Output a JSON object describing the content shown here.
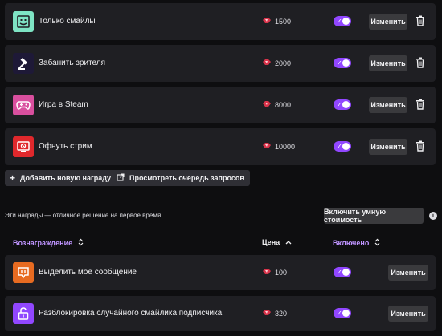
{
  "top_rewards": [
    {
      "title": "Только смайлы",
      "cost": "1500",
      "icon": "smiley-face-icon",
      "color": "#7ee4c4",
      "edit_label": "Изменить"
    },
    {
      "title": "Забанить зрителя",
      "cost": "2000",
      "icon": "hammer-icon",
      "color": "#1e1937",
      "edit_label": "Изменить"
    },
    {
      "title": "Игра в Steam",
      "cost": "8000",
      "icon": "gamepad-icon",
      "color": "#d94f9e",
      "edit_label": "Изменить"
    },
    {
      "title": "Офнуть стрим",
      "cost": "10000",
      "icon": "monitor-off-icon",
      "color": "#e0282c",
      "edit_label": "Изменить"
    }
  ],
  "actions": {
    "add_reward": "Добавить новую награду",
    "view_queue": "Просмотреть очередь запросов"
  },
  "hint_text": "Эти награды — отличное решение на первое время.",
  "smart_cost_button": "Включить умную стоимость",
  "columns": {
    "reward": "Вознаграждение",
    "price": "Цена",
    "enabled": "Включено"
  },
  "bottom_rewards": [
    {
      "title": "Выделить мое сообщение",
      "cost": "100",
      "icon": "highlight-message-icon",
      "color": "#e76b21",
      "edit_label": "Изменить"
    },
    {
      "title": "Разблокировка случайного смайлика подписчика",
      "cost": "320",
      "icon": "unlock-icon",
      "color": "#9147ff",
      "edit_label": "Изменить"
    }
  ],
  "colors": {
    "accent": "#9147ff",
    "background": "#0e0e10",
    "row": "#1f1f23"
  }
}
